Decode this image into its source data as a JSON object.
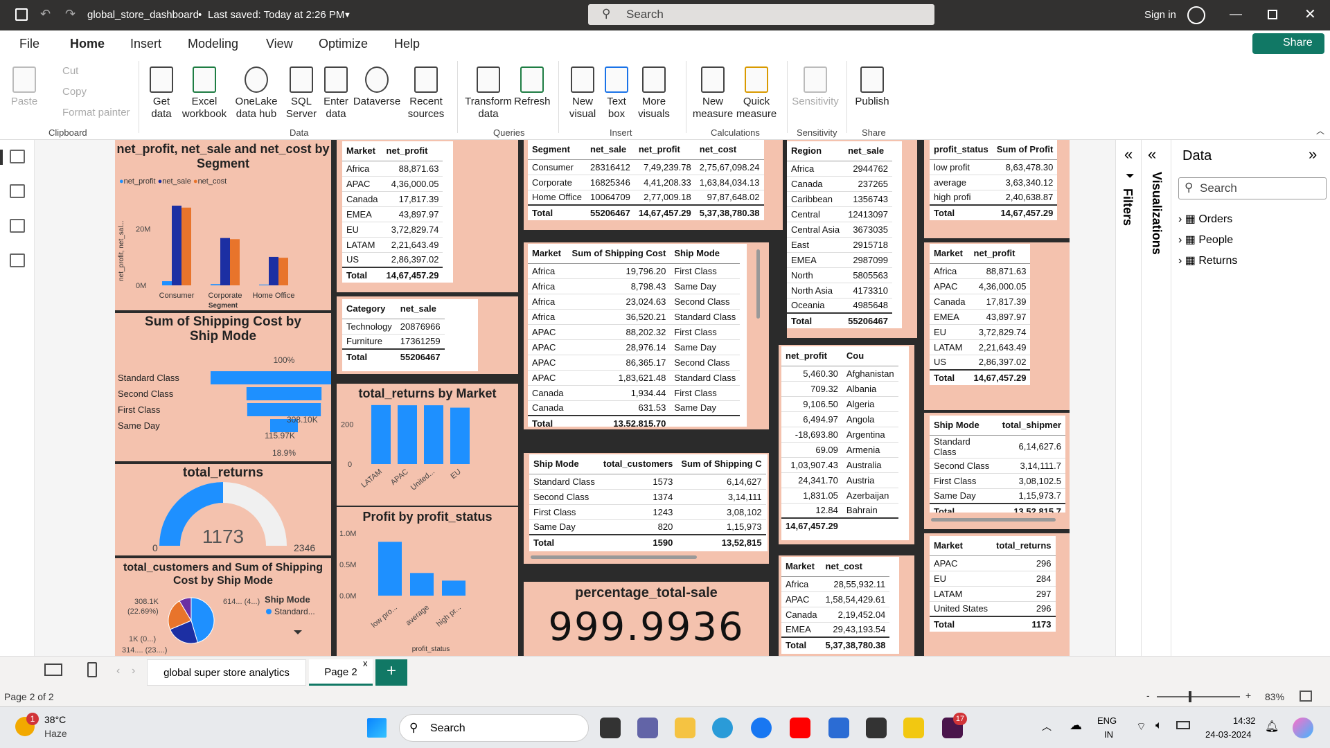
{
  "titlebar": {
    "file": "global_store_dashboard",
    "saved": "Last saved: Today at 2:26 PM",
    "search": "Search",
    "signin": "Sign in"
  },
  "menu": [
    "File",
    "Home",
    "Insert",
    "Modeling",
    "View",
    "Optimize",
    "Help"
  ],
  "share": "Share",
  "ribbon": {
    "clipboard": {
      "paste": "Paste",
      "cut": "Cut",
      "copy": "Copy",
      "format": "Format painter",
      "group": "Clipboard"
    },
    "data": {
      "items": [
        "Get data",
        "Excel workbook",
        "OneLake data hub",
        "SQL Server",
        "Enter data",
        "Dataverse",
        "Recent sources"
      ],
      "group": "Data"
    },
    "queries": {
      "items": [
        "Transform data",
        "Refresh"
      ],
      "group": "Queries"
    },
    "insert": {
      "items": [
        "New visual",
        "Text box",
        "More visuals"
      ],
      "group": "Insert"
    },
    "calc": {
      "items": [
        "New measure",
        "Quick measure"
      ],
      "group": "Calculations"
    },
    "sens": {
      "items": [
        "Sensitivity"
      ],
      "group": "Sensitivity"
    },
    "share": {
      "items": [
        "Publish"
      ],
      "group": "Share"
    }
  },
  "v1": {
    "title": "net_profit, net_sale and net_cost by Segment",
    "legend": [
      "net_profit",
      "net_sale",
      "net_cost"
    ],
    "ylab": "net_profit, net_sal...",
    "xlab": "Segment",
    "ticks": [
      "20M",
      "0M"
    ],
    "chart_data": {
      "type": "bar",
      "categories": [
        "Consumer",
        "Corporate",
        "Home Office"
      ],
      "series": [
        {
          "name": "net_profit",
          "values": [
            1.47,
            0.44,
            0.28
          ]
        },
        {
          "name": "net_sale",
          "values": [
            28.3,
            16.8,
            10.1
          ]
        },
        {
          "name": "net_cost",
          "values": [
            27.6,
            16.4,
            9.8
          ]
        }
      ],
      "colors": [
        "#1e90ff",
        "#1c2fa3",
        "#e8742b"
      ]
    }
  },
  "v2": {
    "headers": [
      "Market",
      "net_profit"
    ],
    "rows": [
      [
        "Africa",
        "88,871.63"
      ],
      [
        "APAC",
        "4,36,000.05"
      ],
      [
        "Canada",
        "17,817.39"
      ],
      [
        "EMEA",
        "43,897.97"
      ],
      [
        "EU",
        "3,72,829.74"
      ],
      [
        "LATAM",
        "2,21,643.49"
      ],
      [
        "US",
        "2,86,397.02"
      ]
    ],
    "total": [
      "Total",
      "14,67,457.29"
    ]
  },
  "v3": {
    "headers": [
      "Segment",
      "net_sale",
      "net_profit",
      "net_cost"
    ],
    "rows": [
      [
        "Consumer",
        "28316412",
        "7,49,239.78",
        "2,75,67,098.24"
      ],
      [
        "Corporate",
        "16825346",
        "4,41,208.33",
        "1,63,84,034.13"
      ],
      [
        "Home Office",
        "10064709",
        "2,77,009.18",
        "97,87,648.02"
      ]
    ],
    "total": [
      "Total",
      "55206467",
      "14,67,457.29",
      "5,37,38,780.38"
    ]
  },
  "v4": {
    "headers": [
      "Region",
      "net_sale"
    ],
    "rows": [
      [
        "Africa",
        "2944762"
      ],
      [
        "Canada",
        "237265"
      ],
      [
        "Caribbean",
        "1356743"
      ],
      [
        "Central",
        "12413097"
      ],
      [
        "Central Asia",
        "3673035"
      ],
      [
        "East",
        "2915718"
      ],
      [
        "EMEA",
        "2987099"
      ],
      [
        "North",
        "5805563"
      ],
      [
        "North Asia",
        "4173310"
      ],
      [
        "Oceania",
        "4985648"
      ]
    ],
    "total": [
      "Total",
      "55206467"
    ]
  },
  "v5": {
    "headers": [
      "profit_status",
      "Sum of Profit"
    ],
    "rows": [
      [
        "low profit",
        "8,63,478.30"
      ],
      [
        "average",
        "3,63,340.12"
      ],
      [
        "high profi",
        "2,40,638.87"
      ]
    ],
    "total": [
      "Total",
      "14,67,457.29"
    ]
  },
  "v6": {
    "title": "Sum of Shipping Cost by Ship Mode",
    "top": "100%",
    "bottom": "18.9%",
    "labels": [
      "308.10K",
      "115.97K"
    ],
    "chart_data": {
      "type": "bar",
      "categories": [
        "Standard Class",
        "Second Class",
        "First Class",
        "Same Day"
      ],
      "values": [
        614627,
        314112,
        308102,
        115973
      ]
    }
  },
  "v7": {
    "headers": [
      "Category",
      "net_sale"
    ],
    "rows": [
      [
        "Technology",
        "20876966"
      ],
      [
        "Furniture",
        "17361259"
      ]
    ],
    "total": [
      "Total",
      "55206467"
    ]
  },
  "v8": {
    "headers": [
      "Market",
      "Sum of Shipping Cost",
      "Ship Mode"
    ],
    "rows": [
      [
        "Africa",
        "19,796.20",
        "First Class"
      ],
      [
        "Africa",
        "8,798.43",
        "Same Day"
      ],
      [
        "Africa",
        "23,024.63",
        "Second Class"
      ],
      [
        "Africa",
        "36,520.21",
        "Standard Class"
      ],
      [
        "APAC",
        "88,202.32",
        "First Class"
      ],
      [
        "APAC",
        "28,976.14",
        "Same Day"
      ],
      [
        "APAC",
        "86,365.17",
        "Second Class"
      ],
      [
        "APAC",
        "1,83,621.48",
        "Standard Class"
      ],
      [
        "Canada",
        "1,934.44",
        "First Class"
      ],
      [
        "Canada",
        "631.53",
        "Same Day"
      ]
    ],
    "total": [
      "Total",
      "13,52,815.70",
      ""
    ]
  },
  "v9": {
    "headers": [
      "net_profit",
      "Cou"
    ],
    "rows": [
      [
        "5,460.30",
        "Afghanistan"
      ],
      [
        "709.32",
        "Albania"
      ],
      [
        "9,106.50",
        "Algeria"
      ],
      [
        "6,494.97",
        "Angola"
      ],
      [
        "-18,693.80",
        "Argentina"
      ],
      [
        "69.09",
        "Armenia"
      ],
      [
        "1,03,907.43",
        "Australia"
      ],
      [
        "24,341.70",
        "Austria"
      ],
      [
        "1,831.05",
        "Azerbaijan"
      ],
      [
        "12.84",
        "Bahrain"
      ]
    ],
    "total": [
      "14,67,457.29",
      ""
    ]
  },
  "v10": {
    "headers": [
      "Market",
      "net_profit"
    ],
    "rows": [
      [
        "Africa",
        "88,871.63"
      ],
      [
        "APAC",
        "4,36,000.05"
      ],
      [
        "Canada",
        "17,817.39"
      ],
      [
        "EMEA",
        "43,897.97"
      ],
      [
        "EU",
        "3,72,829.74"
      ],
      [
        "LATAM",
        "2,21,643.49"
      ],
      [
        "US",
        "2,86,397.02"
      ]
    ],
    "total": [
      "Total",
      "14,67,457.29"
    ]
  },
  "v11": {
    "title": "total_returns by Market",
    "ticks": [
      "200",
      "0"
    ],
    "chart_data": {
      "type": "bar",
      "categories": [
        "LATAM",
        "APAC",
        "United...",
        "EU"
      ],
      "values": [
        297,
        296,
        296,
        284
      ],
      "ylim": [
        0,
        300
      ]
    }
  },
  "v12": {
    "title": "total_returns",
    "min": "0",
    "max": "2346",
    "value": "1173",
    "chart_data": {
      "type": "gauge",
      "value": 1173,
      "max": 2346
    }
  },
  "v13": {
    "headers": [
      "Ship Mode",
      "total_customers",
      "Sum of Shipping C"
    ],
    "rows": [
      [
        "Standard Class",
        "1573",
        "6,14,627"
      ],
      [
        "Second Class",
        "1374",
        "3,14,111"
      ],
      [
        "First Class",
        "1243",
        "3,08,102"
      ],
      [
        "Same Day",
        "820",
        "1,15,973"
      ]
    ],
    "total": [
      "Total",
      "1590",
      "13,52,815"
    ]
  },
  "v14": {
    "headers": [
      "Ship Mode",
      "total_shipmer"
    ],
    "rows": [
      [
        "Standard Class",
        "6,14,627.6"
      ],
      [
        "Second Class",
        "3,14,111.7"
      ],
      [
        "First Class",
        "3,08,102.5"
      ],
      [
        "Same Day",
        "1,15,973.7"
      ]
    ],
    "total": [
      "Total",
      "13,52,815.7"
    ]
  },
  "v15": {
    "title": "Profit by profit_status",
    "ticks": [
      "1.0M",
      "0.5M",
      "0.0M"
    ],
    "xlab": "profit_status",
    "cats": [
      "low pro...",
      "average",
      "high pr..."
    ],
    "chart_data": {
      "type": "bar",
      "categories": [
        "low profit",
        "average",
        "high profit"
      ],
      "values": [
        863478.3,
        363340.12,
        240638.87
      ],
      "ylim": [
        0,
        1000000
      ]
    }
  },
  "v16": {
    "title": "total_customers and Sum of Shipping Cost by Ship Mode",
    "legend_title": "Ship Mode",
    "legend": [
      "Standard..."
    ],
    "labels": [
      "308.1K",
      "(22.69%)",
      "614... (4...)",
      "1K (0...)",
      "314.... (23....)"
    ],
    "chart_data": {
      "type": "pie",
      "categories": [
        "Standard Class",
        "Second Class",
        "First Class",
        "Same Day"
      ],
      "values": [
        614627,
        314112,
        308102,
        115973
      ],
      "colors": [
        "#1e90ff",
        "#1c2fa3",
        "#e8742b",
        "#6b2fa3"
      ]
    }
  },
  "v17": {
    "title": "percentage_total-sale",
    "value": "999.9936"
  },
  "v18": {
    "headers": [
      "Market",
      "net_cost"
    ],
    "rows": [
      [
        "Africa",
        "28,55,932.11"
      ],
      [
        "APAC",
        "1,58,54,429.61"
      ],
      [
        "Canada",
        "2,19,452.04"
      ],
      [
        "EMEA",
        "29,43,193.54"
      ]
    ],
    "total": [
      "Total",
      "5,37,38,780.38"
    ]
  },
  "v19": {
    "headers": [
      "Market",
      "total_returns"
    ],
    "rows": [
      [
        "APAC",
        "296"
      ],
      [
        "EU",
        "284"
      ],
      [
        "LATAM",
        "297"
      ],
      [
        "United States",
        "296"
      ]
    ],
    "total": [
      "Total",
      "1173"
    ]
  },
  "panes": {
    "filters": "Filters",
    "visualizations": "Visualizations",
    "data": "Data",
    "search": "Search",
    "tables": [
      "Orders",
      "People",
      "Returns"
    ]
  },
  "pages": [
    "global super store analytics",
    "Page 2"
  ],
  "status": {
    "page": "Page 2 of 2",
    "zoom": "83%"
  },
  "taskbar": {
    "temp": "38°C",
    "weather": "Haze",
    "search": "Search",
    "lang": "ENG",
    "region": "IN",
    "time": "14:32",
    "date": "24-03-2024",
    "badge1": "1",
    "badge2": "17"
  }
}
